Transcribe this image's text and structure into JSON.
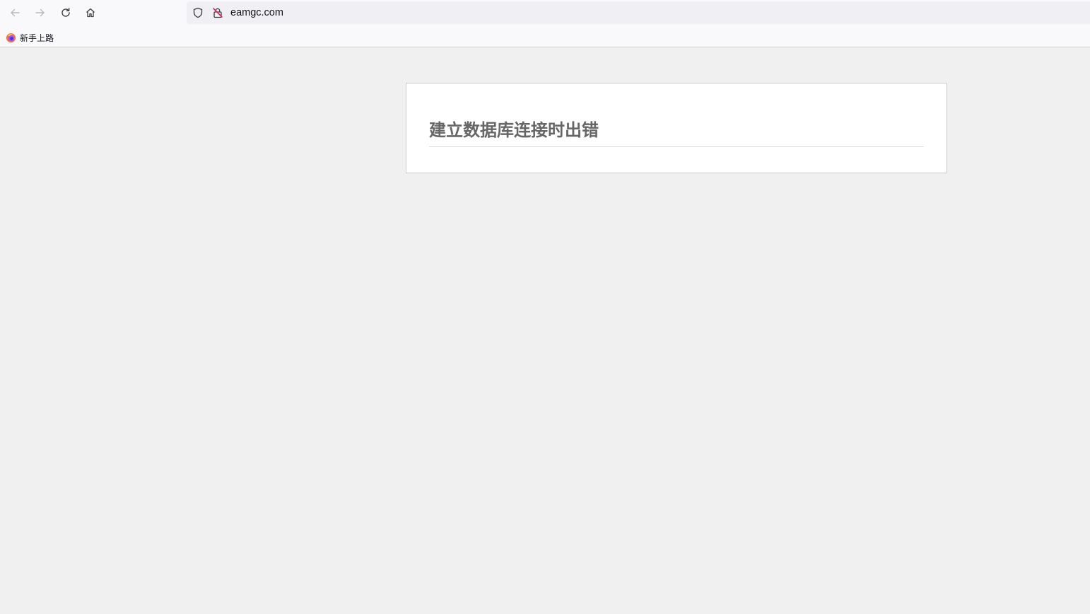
{
  "browser": {
    "url": "eamgc.com",
    "nav": {
      "back_icon": "arrow-left-icon",
      "forward_icon": "arrow-right-icon",
      "reload_icon": "reload-icon",
      "home_icon": "home-icon"
    },
    "url_icons": [
      "shield-icon",
      "insecure-lock-icon"
    ],
    "bookmarks": [
      {
        "label": "新手上路",
        "icon": "firefox-icon"
      }
    ]
  },
  "page": {
    "error_title": "建立数据库连接时出错"
  },
  "colors": {
    "page_background": "#f0f0f0",
    "chrome_background": "#f9f9fb",
    "url_bar_background": "#f0f0f4",
    "error_title": "#666666",
    "insecure_accent": "#e22850"
  }
}
